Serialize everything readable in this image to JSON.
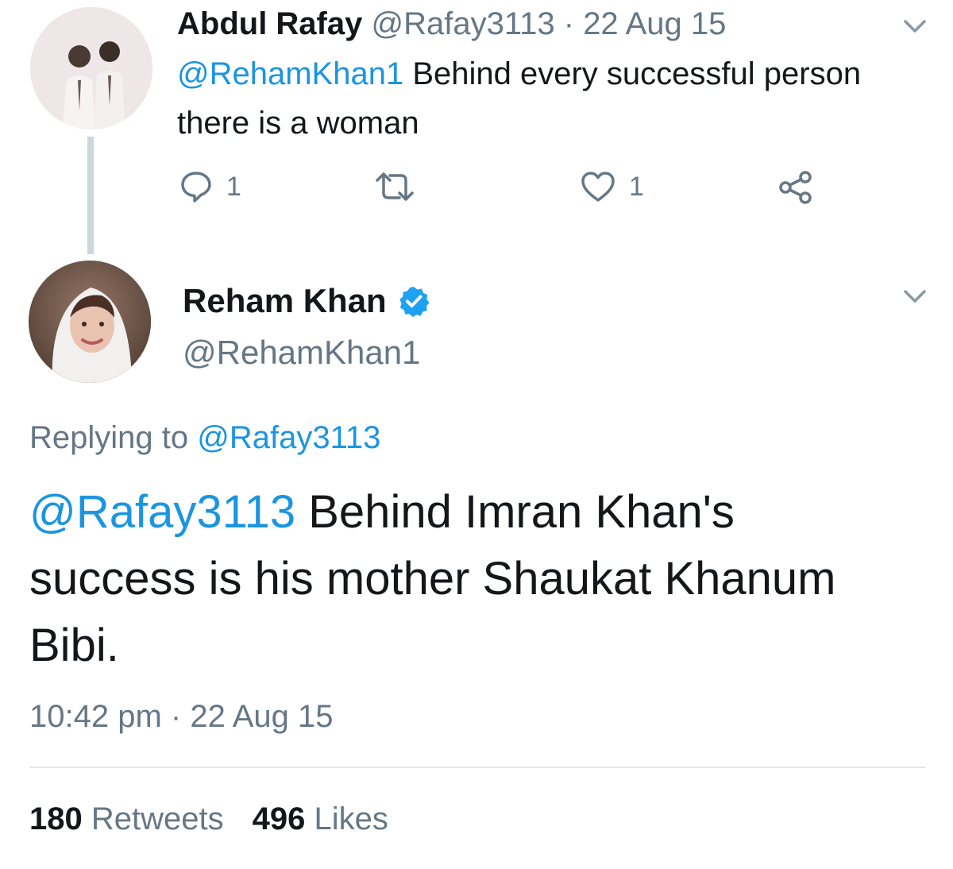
{
  "parent_tweet": {
    "name": "Abdul Rafay",
    "handle": "@Rafay3113",
    "separator": "·",
    "date": "22 Aug 15",
    "mention": "@RehamKhan1",
    "text": " Behind every successful person there is a woman",
    "reply_count": "1",
    "like_count": "1",
    "icons": {
      "reply": "reply-icon",
      "retweet": "retweet-icon",
      "like": "heart-icon",
      "share": "share-icon",
      "menu": "chevron-down-icon"
    }
  },
  "main_tweet": {
    "name": "Reham Khan",
    "handle": "@RehamKhan1",
    "replying_prefix": "Replying to ",
    "replying_to": "@Rafay3113",
    "mention": "@Rafay3113",
    "text": " Behind Imran Khan's success is his mother Shaukat Khanum Bibi.",
    "timestamp": "10:42 pm · 22 Aug 15",
    "retweets_count": "180",
    "retweets_label": " Retweets",
    "likes_count": "496",
    "likes_label": " Likes",
    "icons": {
      "verified": "verified-badge-icon",
      "menu": "chevron-down-icon"
    }
  },
  "colors": {
    "text": "#14171a",
    "secondary": "#657786",
    "link": "#1b95e0",
    "verified": "#1da1f2",
    "divider": "#e1e8ed"
  }
}
